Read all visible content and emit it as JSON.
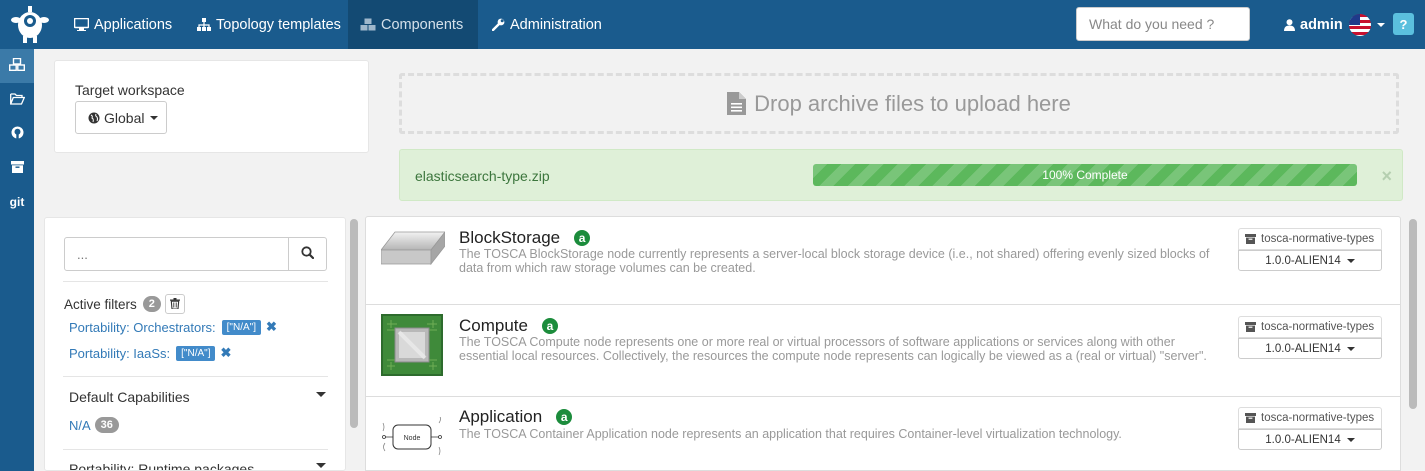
{
  "navbar": {
    "items": [
      {
        "label": "Applications",
        "icon": "desktop-icon"
      },
      {
        "label": "Topology templates",
        "icon": "sitemap-icon"
      },
      {
        "label": "Components",
        "icon": "cubes-icon",
        "active": true
      },
      {
        "label": "Administration",
        "icon": "wrench-icon"
      }
    ],
    "search_placeholder": "What do you need ?",
    "user": "admin",
    "help": "?"
  },
  "sidebar": {
    "items": [
      {
        "icon": "cubes-icon",
        "active": true
      },
      {
        "icon": "folder-open-icon"
      },
      {
        "icon": "github-icon"
      },
      {
        "icon": "archive-icon"
      },
      {
        "icon": "git-icon",
        "text": "git"
      }
    ]
  },
  "workspace": {
    "label": "Target workspace",
    "value": "Global"
  },
  "upload": {
    "drop_text": "Drop archive files to upload here",
    "file_name": "elasticsearch-type.zip",
    "progress_label": "100% Complete",
    "progress_value": 100
  },
  "filters": {
    "search_placeholder": "...",
    "active_label": "Active filters",
    "active_count": "2",
    "active": [
      {
        "label": "Portability: Orchestrators:",
        "value": "[\"N/A\"]"
      },
      {
        "label": "Portability: IaaSs:",
        "value": "[\"N/A\"]"
      }
    ],
    "section1_title": "Default Capabilities",
    "section1_item": "N/A",
    "section1_count": "36",
    "section2_title": "Portability: Runtime packages"
  },
  "components": [
    {
      "name": "BlockStorage",
      "badge": "a",
      "description": "The TOSCA BlockStorage node currently represents a server-local block storage device (i.e., not shared) offering evenly sized blocks of data from which raw storage volumes can be created.",
      "archive": "tosca-normative-types",
      "version": "1.0.0-ALIEN14"
    },
    {
      "name": "Compute",
      "badge": "a",
      "description": "The TOSCA Compute node represents one or more real or virtual processors of software applications or services along with other essential local resources. Collectively, the resources the compute node represents can logically be viewed as a (real or virtual) \"server\".",
      "archive": "tosca-normative-types",
      "version": "1.0.0-ALIEN14"
    },
    {
      "name": "Application",
      "badge": "a",
      "icon_label": "Node",
      "description": "The TOSCA Container Application node represents an application that requires Container-level virtualization technology.",
      "archive": "tosca-normative-types",
      "version": "1.0.0-ALIEN14"
    }
  ]
}
